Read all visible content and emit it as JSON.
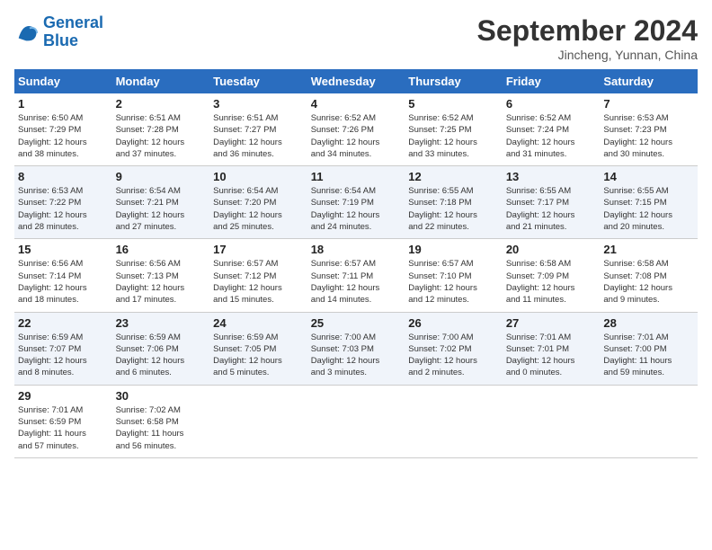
{
  "header": {
    "logo_line1": "General",
    "logo_line2": "Blue",
    "month": "September 2024",
    "location": "Jincheng, Yunnan, China"
  },
  "columns": [
    "Sunday",
    "Monday",
    "Tuesday",
    "Wednesday",
    "Thursday",
    "Friday",
    "Saturday"
  ],
  "weeks": [
    [
      {
        "day": "1",
        "info": "Sunrise: 6:50 AM\nSunset: 7:29 PM\nDaylight: 12 hours\nand 38 minutes."
      },
      {
        "day": "2",
        "info": "Sunrise: 6:51 AM\nSunset: 7:28 PM\nDaylight: 12 hours\nand 37 minutes."
      },
      {
        "day": "3",
        "info": "Sunrise: 6:51 AM\nSunset: 7:27 PM\nDaylight: 12 hours\nand 36 minutes."
      },
      {
        "day": "4",
        "info": "Sunrise: 6:52 AM\nSunset: 7:26 PM\nDaylight: 12 hours\nand 34 minutes."
      },
      {
        "day": "5",
        "info": "Sunrise: 6:52 AM\nSunset: 7:25 PM\nDaylight: 12 hours\nand 33 minutes."
      },
      {
        "day": "6",
        "info": "Sunrise: 6:52 AM\nSunset: 7:24 PM\nDaylight: 12 hours\nand 31 minutes."
      },
      {
        "day": "7",
        "info": "Sunrise: 6:53 AM\nSunset: 7:23 PM\nDaylight: 12 hours\nand 30 minutes."
      }
    ],
    [
      {
        "day": "8",
        "info": "Sunrise: 6:53 AM\nSunset: 7:22 PM\nDaylight: 12 hours\nand 28 minutes."
      },
      {
        "day": "9",
        "info": "Sunrise: 6:54 AM\nSunset: 7:21 PM\nDaylight: 12 hours\nand 27 minutes."
      },
      {
        "day": "10",
        "info": "Sunrise: 6:54 AM\nSunset: 7:20 PM\nDaylight: 12 hours\nand 25 minutes."
      },
      {
        "day": "11",
        "info": "Sunrise: 6:54 AM\nSunset: 7:19 PM\nDaylight: 12 hours\nand 24 minutes."
      },
      {
        "day": "12",
        "info": "Sunrise: 6:55 AM\nSunset: 7:18 PM\nDaylight: 12 hours\nand 22 minutes."
      },
      {
        "day": "13",
        "info": "Sunrise: 6:55 AM\nSunset: 7:17 PM\nDaylight: 12 hours\nand 21 minutes."
      },
      {
        "day": "14",
        "info": "Sunrise: 6:55 AM\nSunset: 7:15 PM\nDaylight: 12 hours\nand 20 minutes."
      }
    ],
    [
      {
        "day": "15",
        "info": "Sunrise: 6:56 AM\nSunset: 7:14 PM\nDaylight: 12 hours\nand 18 minutes."
      },
      {
        "day": "16",
        "info": "Sunrise: 6:56 AM\nSunset: 7:13 PM\nDaylight: 12 hours\nand 17 minutes."
      },
      {
        "day": "17",
        "info": "Sunrise: 6:57 AM\nSunset: 7:12 PM\nDaylight: 12 hours\nand 15 minutes."
      },
      {
        "day": "18",
        "info": "Sunrise: 6:57 AM\nSunset: 7:11 PM\nDaylight: 12 hours\nand 14 minutes."
      },
      {
        "day": "19",
        "info": "Sunrise: 6:57 AM\nSunset: 7:10 PM\nDaylight: 12 hours\nand 12 minutes."
      },
      {
        "day": "20",
        "info": "Sunrise: 6:58 AM\nSunset: 7:09 PM\nDaylight: 12 hours\nand 11 minutes."
      },
      {
        "day": "21",
        "info": "Sunrise: 6:58 AM\nSunset: 7:08 PM\nDaylight: 12 hours\nand 9 minutes."
      }
    ],
    [
      {
        "day": "22",
        "info": "Sunrise: 6:59 AM\nSunset: 7:07 PM\nDaylight: 12 hours\nand 8 minutes."
      },
      {
        "day": "23",
        "info": "Sunrise: 6:59 AM\nSunset: 7:06 PM\nDaylight: 12 hours\nand 6 minutes."
      },
      {
        "day": "24",
        "info": "Sunrise: 6:59 AM\nSunset: 7:05 PM\nDaylight: 12 hours\nand 5 minutes."
      },
      {
        "day": "25",
        "info": "Sunrise: 7:00 AM\nSunset: 7:03 PM\nDaylight: 12 hours\nand 3 minutes."
      },
      {
        "day": "26",
        "info": "Sunrise: 7:00 AM\nSunset: 7:02 PM\nDaylight: 12 hours\nand 2 minutes."
      },
      {
        "day": "27",
        "info": "Sunrise: 7:01 AM\nSunset: 7:01 PM\nDaylight: 12 hours\nand 0 minutes."
      },
      {
        "day": "28",
        "info": "Sunrise: 7:01 AM\nSunset: 7:00 PM\nDaylight: 11 hours\nand 59 minutes."
      }
    ],
    [
      {
        "day": "29",
        "info": "Sunrise: 7:01 AM\nSunset: 6:59 PM\nDaylight: 11 hours\nand 57 minutes."
      },
      {
        "day": "30",
        "info": "Sunrise: 7:02 AM\nSunset: 6:58 PM\nDaylight: 11 hours\nand 56 minutes."
      },
      {
        "day": "",
        "info": ""
      },
      {
        "day": "",
        "info": ""
      },
      {
        "day": "",
        "info": ""
      },
      {
        "day": "",
        "info": ""
      },
      {
        "day": "",
        "info": ""
      }
    ]
  ]
}
